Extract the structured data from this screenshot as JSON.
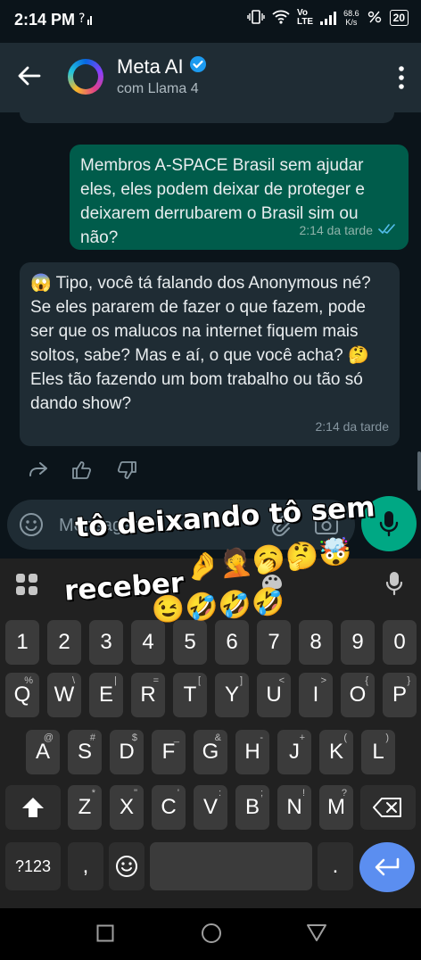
{
  "status_bar": {
    "time": "2:14 PM",
    "net_speed_value": "68.6",
    "net_speed_unit": "K/s",
    "battery": "20",
    "lte": "LTE",
    "vo": "Vo"
  },
  "header": {
    "title": "Meta AI",
    "subtitle": "com Llama 4"
  },
  "messages": [
    {
      "direction": "outgoing",
      "text": "Membros A-SPACE Brasil sem ajudar eles, eles podem deixar de proteger e deixarem derrubarem o Brasil sim ou não?",
      "time": "2:14 da tarde",
      "read": true
    },
    {
      "direction": "incoming",
      "text": "😱 Tipo, você tá falando dos Anonymous né? Se eles pararem de fazer o que fazem, pode ser que os malucos na internet fiquem mais soltos, sabe? Mas e aí, o que você acha? 🤔 Eles tão fazendo um bom trabalho ou tão só dando show?",
      "time": "2:14 da tarde"
    }
  ],
  "composer": {
    "placeholder": "Mensagem"
  },
  "overlay": {
    "line1": "tô deixando tô sem",
    "line2": "receber",
    "emojis_row1": "🤌🤦🥱🤔🤯",
    "emojis_row2": "😉🤣🤣🤣"
  },
  "keyboard": {
    "number_row": [
      "1",
      "2",
      "3",
      "4",
      "5",
      "6",
      "7",
      "8",
      "9",
      "0"
    ],
    "row1": [
      {
        "k": "Q",
        "h": "%"
      },
      {
        "k": "W",
        "h": "\\"
      },
      {
        "k": "E",
        "h": "|"
      },
      {
        "k": "R",
        "h": "="
      },
      {
        "k": "T",
        "h": "["
      },
      {
        "k": "Y",
        "h": "]"
      },
      {
        "k": "U",
        "h": "<"
      },
      {
        "k": "I",
        "h": ">"
      },
      {
        "k": "O",
        "h": "{"
      },
      {
        "k": "P",
        "h": "}"
      }
    ],
    "row2": [
      {
        "k": "A",
        "h": "@"
      },
      {
        "k": "S",
        "h": "#"
      },
      {
        "k": "D",
        "h": "$"
      },
      {
        "k": "F",
        "h": "_"
      },
      {
        "k": "G",
        "h": "&"
      },
      {
        "k": "H",
        "h": "-"
      },
      {
        "k": "J",
        "h": "+"
      },
      {
        "k": "K",
        "h": "("
      },
      {
        "k": "L",
        "h": ")"
      }
    ],
    "row3": [
      {
        "k": "Z",
        "h": "*"
      },
      {
        "k": "X",
        "h": "\""
      },
      {
        "k": "C",
        "h": "'"
      },
      {
        "k": "V",
        "h": ":"
      },
      {
        "k": "B",
        "h": ";"
      },
      {
        "k": "N",
        "h": "!"
      },
      {
        "k": "M",
        "h": "?"
      }
    ],
    "symbols_label": "?123",
    "comma": ",",
    "period": "."
  },
  "colors": {
    "outgoing_bubble": "#005c4b",
    "incoming_bubble": "#1f2c34",
    "accent": "#00a884",
    "enter_key": "#5b8ef0"
  }
}
